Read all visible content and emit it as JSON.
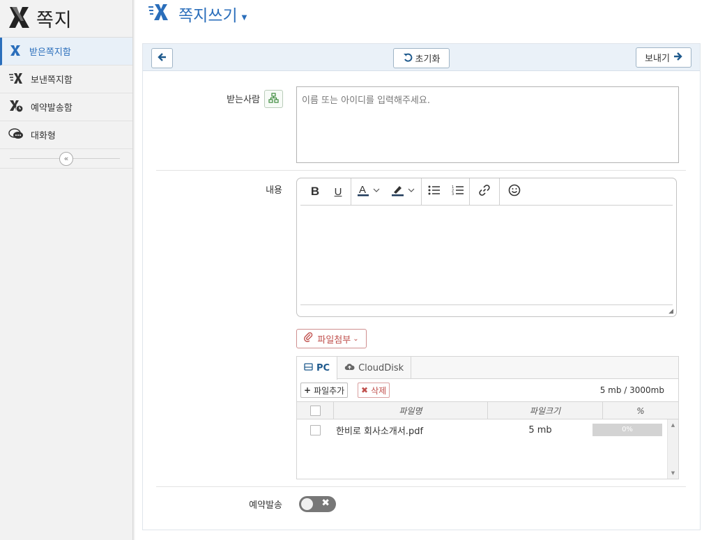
{
  "app": {
    "title": "쪽지"
  },
  "sidebar": {
    "items": [
      {
        "label": "받은쪽지함",
        "icon": "inbox-note-icon",
        "active": true
      },
      {
        "label": "보낸쪽지함",
        "icon": "sent-note-icon",
        "active": false
      },
      {
        "label": "예약발송함",
        "icon": "scheduled-note-icon",
        "active": false
      },
      {
        "label": "대화형",
        "icon": "chat-icon",
        "active": false
      }
    ],
    "collapse_icon": "double-chevron-left-icon"
  },
  "header": {
    "title": "쪽지쓰기"
  },
  "toolbar": {
    "reset_label": "초기화",
    "send_label": "보내기"
  },
  "form": {
    "recipient_label": "받는사람",
    "recipient_placeholder": "이름 또는 아이디를 입력해주세요.",
    "content_label": "내용",
    "schedule_label": "예약발송",
    "schedule_enabled": false
  },
  "editor": {
    "tools": [
      "bold",
      "underline",
      "font-color",
      "highlight",
      "bullet-list",
      "numbered-list",
      "link",
      "emoji"
    ]
  },
  "attachment": {
    "button_label": "파일첨부",
    "tabs": [
      {
        "label": "PC",
        "active": true
      },
      {
        "label": "CloudDisk",
        "active": false
      }
    ],
    "add_label": "파일추가",
    "delete_label": "삭제",
    "size_info": "5 mb / 3000mb",
    "columns": {
      "name": "파일명",
      "size": "파일크기",
      "percent": "%"
    },
    "files": [
      {
        "name": "한비로 회사소개서.pdf",
        "size": "5 mb",
        "progress": "0%"
      }
    ]
  },
  "colors": {
    "accent": "#2a6ebb",
    "danger": "#c0504d",
    "toolbar_bg": "#eaf1f8"
  }
}
